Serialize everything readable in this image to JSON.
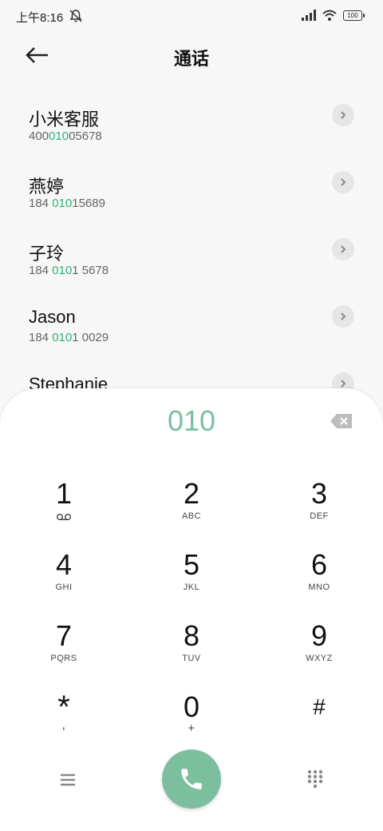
{
  "status_bar": {
    "time": "上午8:16",
    "battery": "100"
  },
  "header": {
    "title": "通话"
  },
  "contacts": [
    {
      "name": "小米客服",
      "num_pre": "400",
      "num_hl": "010",
      "num_post": "05678"
    },
    {
      "name": "燕婷",
      "num_pre": "184 ",
      "num_hl": "010",
      "num_post": "15689"
    },
    {
      "name": "子玲",
      "num_pre": "184 ",
      "num_hl": "010",
      "num_post": "1 5678"
    },
    {
      "name": "Jason",
      "num_pre": "184 ",
      "num_hl": "010",
      "num_post": "1 0029"
    },
    {
      "name": "Stephanie",
      "num_pre": "",
      "num_hl": "",
      "num_post": ""
    }
  ],
  "dialpad": {
    "entered_number": "010",
    "keys": [
      {
        "digit": "1",
        "letters": ""
      },
      {
        "digit": "2",
        "letters": "ABC"
      },
      {
        "digit": "3",
        "letters": "DEF"
      },
      {
        "digit": "4",
        "letters": "GHI"
      },
      {
        "digit": "5",
        "letters": "JKL"
      },
      {
        "digit": "6",
        "letters": "MNO"
      },
      {
        "digit": "7",
        "letters": "PQRS"
      },
      {
        "digit": "8",
        "letters": "TUV"
      },
      {
        "digit": "9",
        "letters": "WXYZ"
      },
      {
        "digit": "*",
        "letters": ","
      },
      {
        "digit": "0",
        "letters": "+"
      },
      {
        "digit": "#",
        "letters": ""
      }
    ]
  },
  "colors": {
    "accent": "#2fb37a",
    "call_button": "#7cbf9f"
  },
  "icons": {
    "back": "arrow-left-icon",
    "mute": "bell-off-icon",
    "signal": "signal-icon",
    "wifi": "wifi-icon",
    "battery": "battery-icon",
    "row_arrow": "chevron-right-icon",
    "backspace": "backspace-icon",
    "voicemail": "voicemail-icon",
    "menu": "menu-icon",
    "call": "phone-icon",
    "keypad": "dialpad-icon"
  }
}
